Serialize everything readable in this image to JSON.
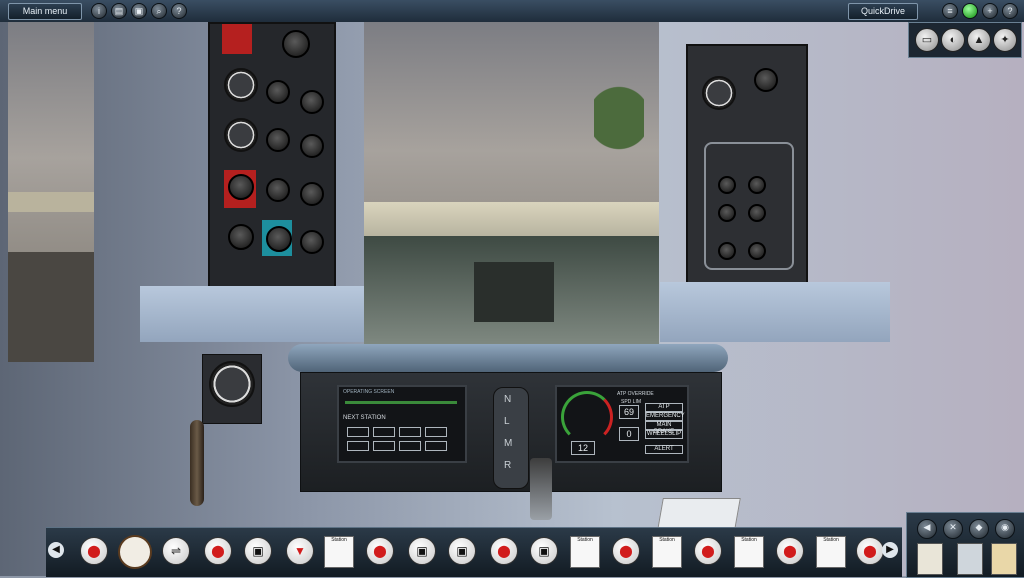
{
  "topbar": {
    "main_menu_label": "Main menu",
    "quickdrive_label": "QuickDrive"
  },
  "cab": {
    "hmi": {
      "header_left": "OPERATING SCREEN",
      "next_station_label": "NEXT STATION",
      "speed_limit_label": "SPD LIM",
      "speed_limit_value": "69",
      "speed_value": "12",
      "dist_value": "0",
      "buttons": [
        "ATP OVERRIDE",
        "ATP",
        "EMERGENCY",
        "MAIN BRAKE",
        "WHEELSLIP",
        "ALERT"
      ]
    },
    "lever_letters": [
      "N",
      "L",
      "M",
      "R"
    ]
  },
  "toolbar": {
    "station_label": "Station"
  },
  "icons": {
    "top_right_views": [
      "cab-view-icon",
      "head-out-icon",
      "tracking-cam-icon",
      "trackside-cam-icon"
    ]
  },
  "colors": {
    "topbar": "#2b3c4d",
    "accent_red": "#d11c1c",
    "status_green": "#1fb21f"
  }
}
